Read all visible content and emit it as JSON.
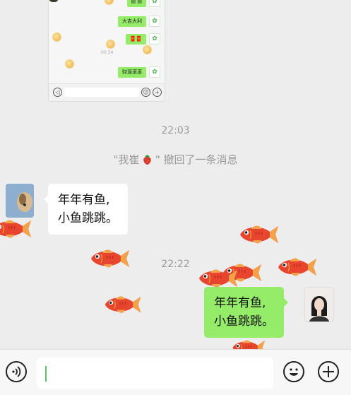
{
  "embedded_card": {
    "bubbles": [
      "▤ ▤",
      "大吉大利",
      "🧧🧧",
      "财源滚滚"
    ],
    "timestamp": "00:34"
  },
  "chat": {
    "time1": "22:03",
    "recall_text": "\"我崔",
    "recall_suffix": "\" 撤回了一条消息",
    "incoming_line1": "年年有鱼,",
    "incoming_line2": "小鱼跳跳。",
    "time2": "22:22",
    "outgoing_line1": "年年有鱼,",
    "outgoing_line2": "小鱼跳跳。"
  },
  "colors": {
    "background": "#ededed",
    "outgoing_bubble": "#95ec69",
    "incoming_bubble": "#ffffff",
    "fish": "#e8452f"
  },
  "icons": {
    "voice": "voice-icon",
    "emoji": "emoji-icon",
    "plus": "plus-icon"
  }
}
